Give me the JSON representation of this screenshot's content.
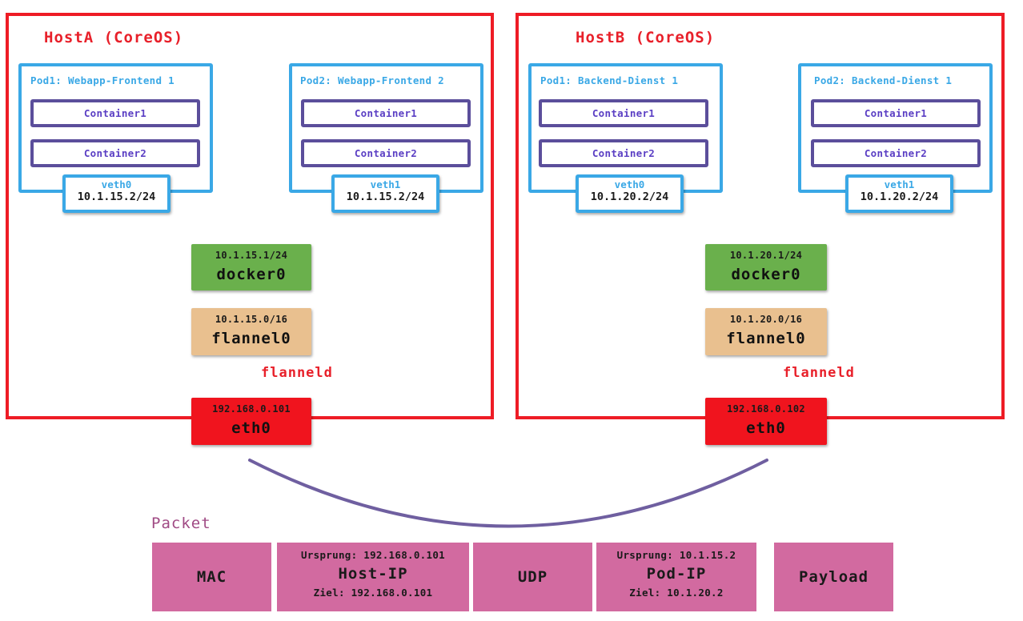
{
  "hosts": [
    {
      "title": "HostA (CoreOS)",
      "pods": [
        {
          "title": "Pod1: Webapp-Frontend 1",
          "containers": [
            "Container1",
            "Container2"
          ],
          "veth_name": "veth0",
          "veth_ip": "10.1.15.2/24"
        },
        {
          "title": "Pod2: Webapp-Frontend 2",
          "containers": [
            "Container1",
            "Container2"
          ],
          "veth_name": "veth1",
          "veth_ip": "10.1.15.2/24"
        }
      ],
      "docker": {
        "ip": "10.1.15.1/24",
        "name": "docker0"
      },
      "flannel": {
        "ip": "10.1.15.0/16",
        "name": "flannel0"
      },
      "daemon": "flanneld",
      "eth": {
        "ip": "192.168.0.101",
        "name": "eth0"
      }
    },
    {
      "title": "HostB (CoreOS)",
      "pods": [
        {
          "title": "Pod1: Backend-Dienst 1",
          "containers": [
            "Container1",
            "Container2"
          ],
          "veth_name": "veth0",
          "veth_ip": "10.1.20.2/24"
        },
        {
          "title": "Pod2: Backend-Dienst 1",
          "containers": [
            "Container1",
            "Container2"
          ],
          "veth_name": "veth1",
          "veth_ip": "10.1.20.2/24"
        }
      ],
      "docker": {
        "ip": "10.1.20.1/24",
        "name": "docker0"
      },
      "flannel": {
        "ip": "10.1.20.0/16",
        "name": "flannel0"
      },
      "daemon": "flanneld",
      "eth": {
        "ip": "192.168.0.102",
        "name": "eth0"
      }
    }
  ],
  "packet": {
    "label": "Packet",
    "segments": [
      {
        "name": "MAC"
      },
      {
        "name": "Host-IP",
        "source": "Ursprung: 192.168.0.101",
        "dest": "Ziel: 192.168.0.101"
      },
      {
        "name": "UDP"
      },
      {
        "name": "Pod-IP",
        "source": "Ursprung: 10.1.15.2",
        "dest": "Ziel: 10.1.20.2"
      },
      {
        "name": "Payload"
      }
    ]
  },
  "colors": {
    "host_border": "#ee1c25",
    "pod_border": "#3aa8e6",
    "container_border": "#5b4e9b",
    "docker_bridge": "#6ab04c",
    "flannel_iface": "#e9c08f",
    "eth_iface": "#f0141e",
    "packet_segment": "#d26aa0",
    "arc": "#6f5fa0"
  }
}
